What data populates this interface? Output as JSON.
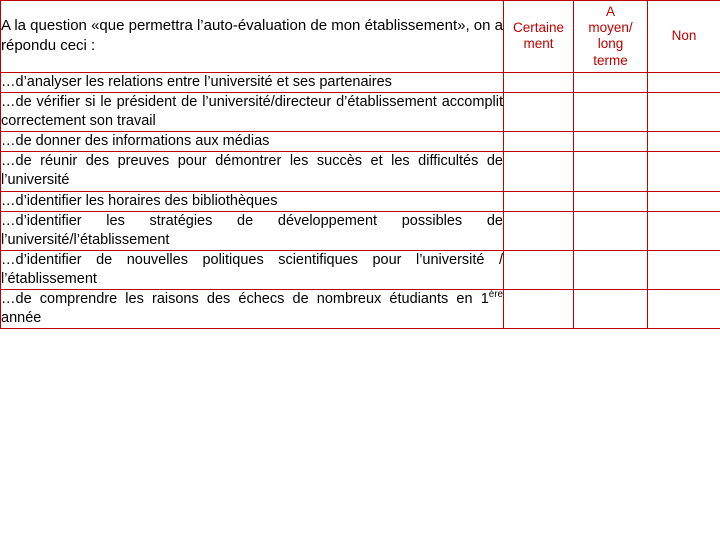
{
  "document": {
    "question_intro": "A la question «que permettra l’auto-évaluation de mon établissement», on a répondu ceci :",
    "columns": [
      {
        "id": "certainement",
        "label": "Certaine\nment"
      },
      {
        "id": "moyen_long_terme",
        "label": "A moyen/ long terme"
      },
      {
        "id": "non",
        "label": "Non"
      }
    ],
    "column_labels": {
      "certainement_line1": "Certaine",
      "certainement_line2": "ment",
      "moyen_line1": "A",
      "moyen_line2": "moyen/",
      "moyen_line3": "long",
      "moyen_line4": "terme",
      "non": "Non"
    },
    "accent_color": "#c00000",
    "text_color": "#000000",
    "rows": [
      {
        "text": "…d’analyser les relations entre l’université et ses partenaires"
      },
      {
        "text": "…de vérifier si le président de l’université/directeur d’établissement accomplit correctement son travail"
      },
      {
        "text": "…de donner des informations aux médias"
      },
      {
        "text": "…de réunir des preuves pour démontrer les succès et les difficultés de l’université"
      },
      {
        "text": "…d’identifier les horaires des bibliothèques"
      },
      {
        "text": "…d’identifier les stratégies de développement possibles de l’université/l’établissement"
      },
      {
        "text": "…d’identifier de nouvelles politiques scientifiques pour l’université / l’établissement"
      },
      {
        "text_part1": "…de comprendre les raisons des échecs de nombreux étudiants en 1",
        "text_sup": "ère",
        "text_part2": " année"
      }
    ]
  }
}
